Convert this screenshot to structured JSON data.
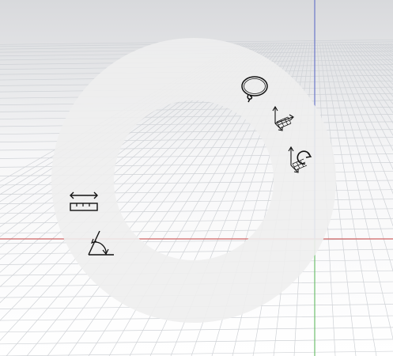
{
  "viewport": {
    "kind": "3d-viewport",
    "background_top": "#d8d9dc",
    "background_bottom": "#ffffff",
    "grid_color": "#cfd2d6",
    "axis_x_color": "#d06565",
    "axis_y_color": "#6fbf6f",
    "axis_z_color": "#6b78c9"
  },
  "radial_menu": {
    "ring_color": "#eeeeee",
    "icon_color": "#111111",
    "tools": [
      {
        "id": "lasso",
        "icon": "lasso-select-icon"
      },
      {
        "id": "move",
        "icon": "move-gizmo-icon"
      },
      {
        "id": "rotate",
        "icon": "rotate-gizmo-icon"
      },
      {
        "id": "measure",
        "icon": "ruler-measure-icon"
      },
      {
        "id": "angle",
        "icon": "angle-measure-icon"
      }
    ]
  }
}
